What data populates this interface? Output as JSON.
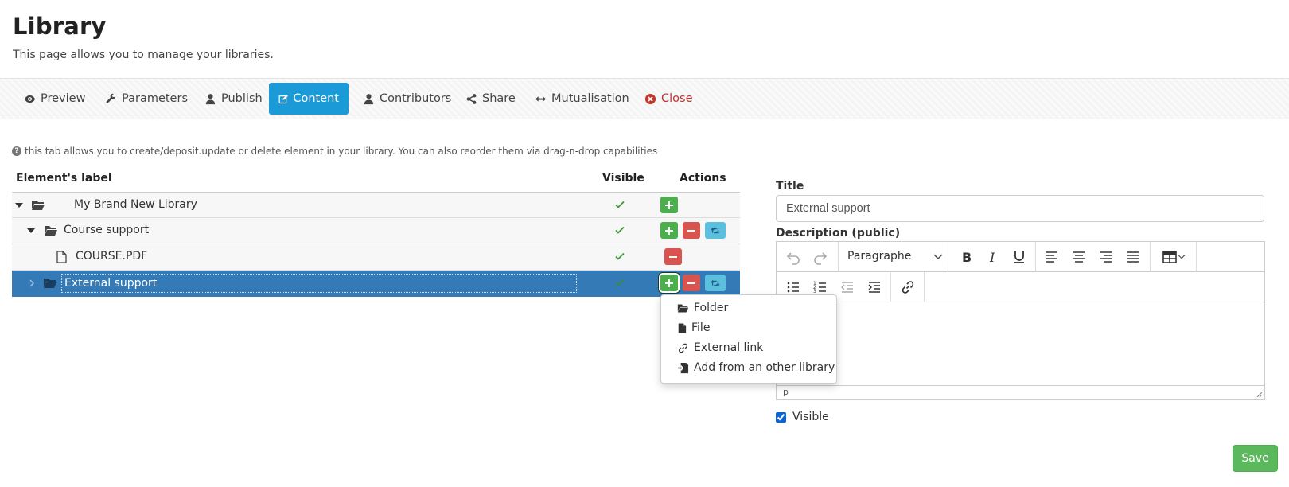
{
  "page": {
    "title": "Library",
    "subtitle": "This page allows you to manage your libraries."
  },
  "tabs": [
    {
      "label": "Preview",
      "icon": "eye-icon"
    },
    {
      "label": "Parameters",
      "icon": "wrench-icon"
    },
    {
      "label": "Publish",
      "icon": "user-icon"
    },
    {
      "label": "Content",
      "icon": "edit-icon",
      "active": true
    },
    {
      "label": "Contributors",
      "icon": "user-icon"
    },
    {
      "label": "Share",
      "icon": "share-icon"
    },
    {
      "label": "Mutualisation",
      "icon": "arrows-horizontal-icon"
    },
    {
      "label": "Close",
      "icon": "close-circle-icon"
    }
  ],
  "hint": "this tab allows you to create/deposit.update or delete element in your library. You can also reorder them via drag-n-drop capabilities",
  "tree": {
    "headers": {
      "label": "Element's label",
      "visible": "Visible",
      "actions": "Actions"
    },
    "rows": [
      {
        "label": "My Brand New Library",
        "type": "folder",
        "visible": true,
        "expanded": true
      },
      {
        "label": "Course support",
        "type": "folder",
        "visible": true,
        "expanded": true
      },
      {
        "label": "COURSE.PDF",
        "type": "file",
        "visible": true
      },
      {
        "label": "External support",
        "type": "folder",
        "visible": true,
        "expanded": false,
        "selected": true
      }
    ]
  },
  "add_menu": {
    "items": [
      {
        "label": "Folder",
        "icon": "folder-open-icon"
      },
      {
        "label": "File",
        "icon": "file-icon"
      },
      {
        "label": "External link",
        "icon": "link-icon"
      },
      {
        "label": "Add from an other library",
        "icon": "import-icon"
      }
    ]
  },
  "form": {
    "title_label": "Title",
    "title_value": "External support",
    "description_label": "Description (public)",
    "format_value": "Paragraphe",
    "status_path": "p",
    "visible_label": "Visible",
    "visible_checked": true,
    "save_label": "Save"
  },
  "colors": {
    "active_tab": "#1a9ad6",
    "selected_row": "#337ab7",
    "add_button": "#4cae4c",
    "delete_button": "#d9534f",
    "move_button": "#5bc0de",
    "save_button": "#5cb85c",
    "close_tab": "#b33333"
  }
}
